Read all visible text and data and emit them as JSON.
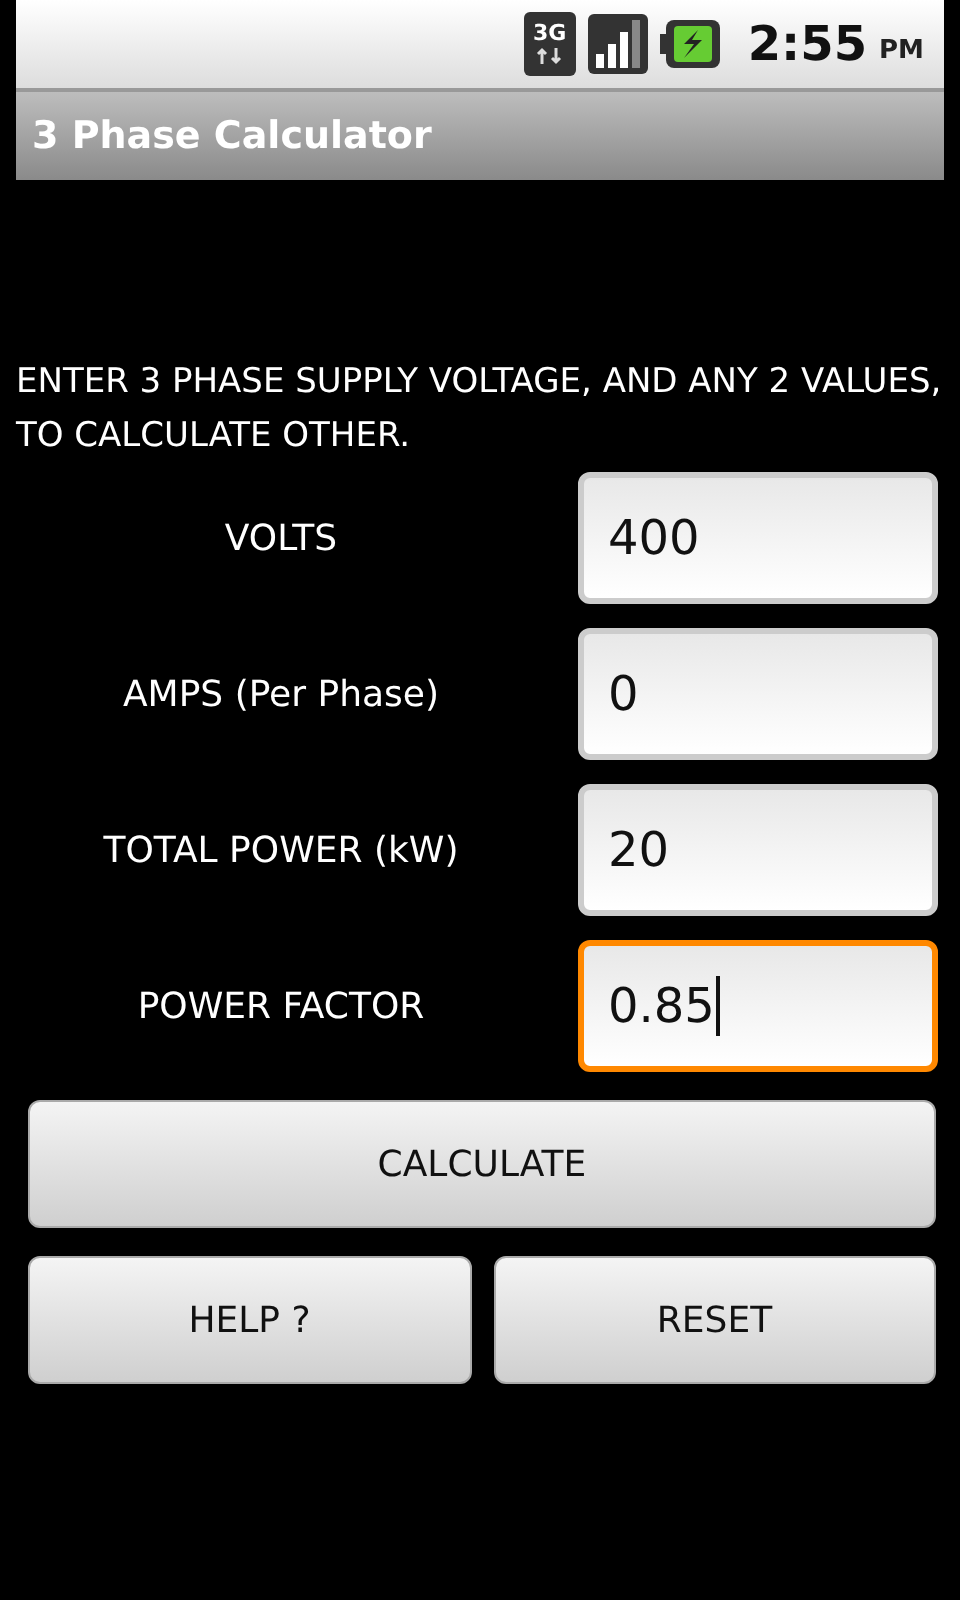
{
  "status_bar": {
    "network": "3G",
    "time": "2:55",
    "meridiem": "PM"
  },
  "title_bar": {
    "title": "3 Phase Calculator"
  },
  "instructions": "ENTER 3 PHASE SUPPLY VOLTAGE, AND ANY 2 VALUES, TO CALCULATE OTHER.",
  "fields": [
    {
      "label": "VOLTS",
      "value": "400",
      "focused": false
    },
    {
      "label": "AMPS (Per Phase)",
      "value": "0",
      "focused": false
    },
    {
      "label": "TOTAL POWER (kW)",
      "value": "20",
      "focused": false
    },
    {
      "label": "POWER FACTOR",
      "value": "0.85",
      "focused": true
    }
  ],
  "buttons": [
    {
      "label": "CALCULATE",
      "kind": "wide"
    },
    {
      "label": "HELP ?",
      "kind": "half"
    },
    {
      "label": "RESET",
      "kind": "half"
    }
  ]
}
